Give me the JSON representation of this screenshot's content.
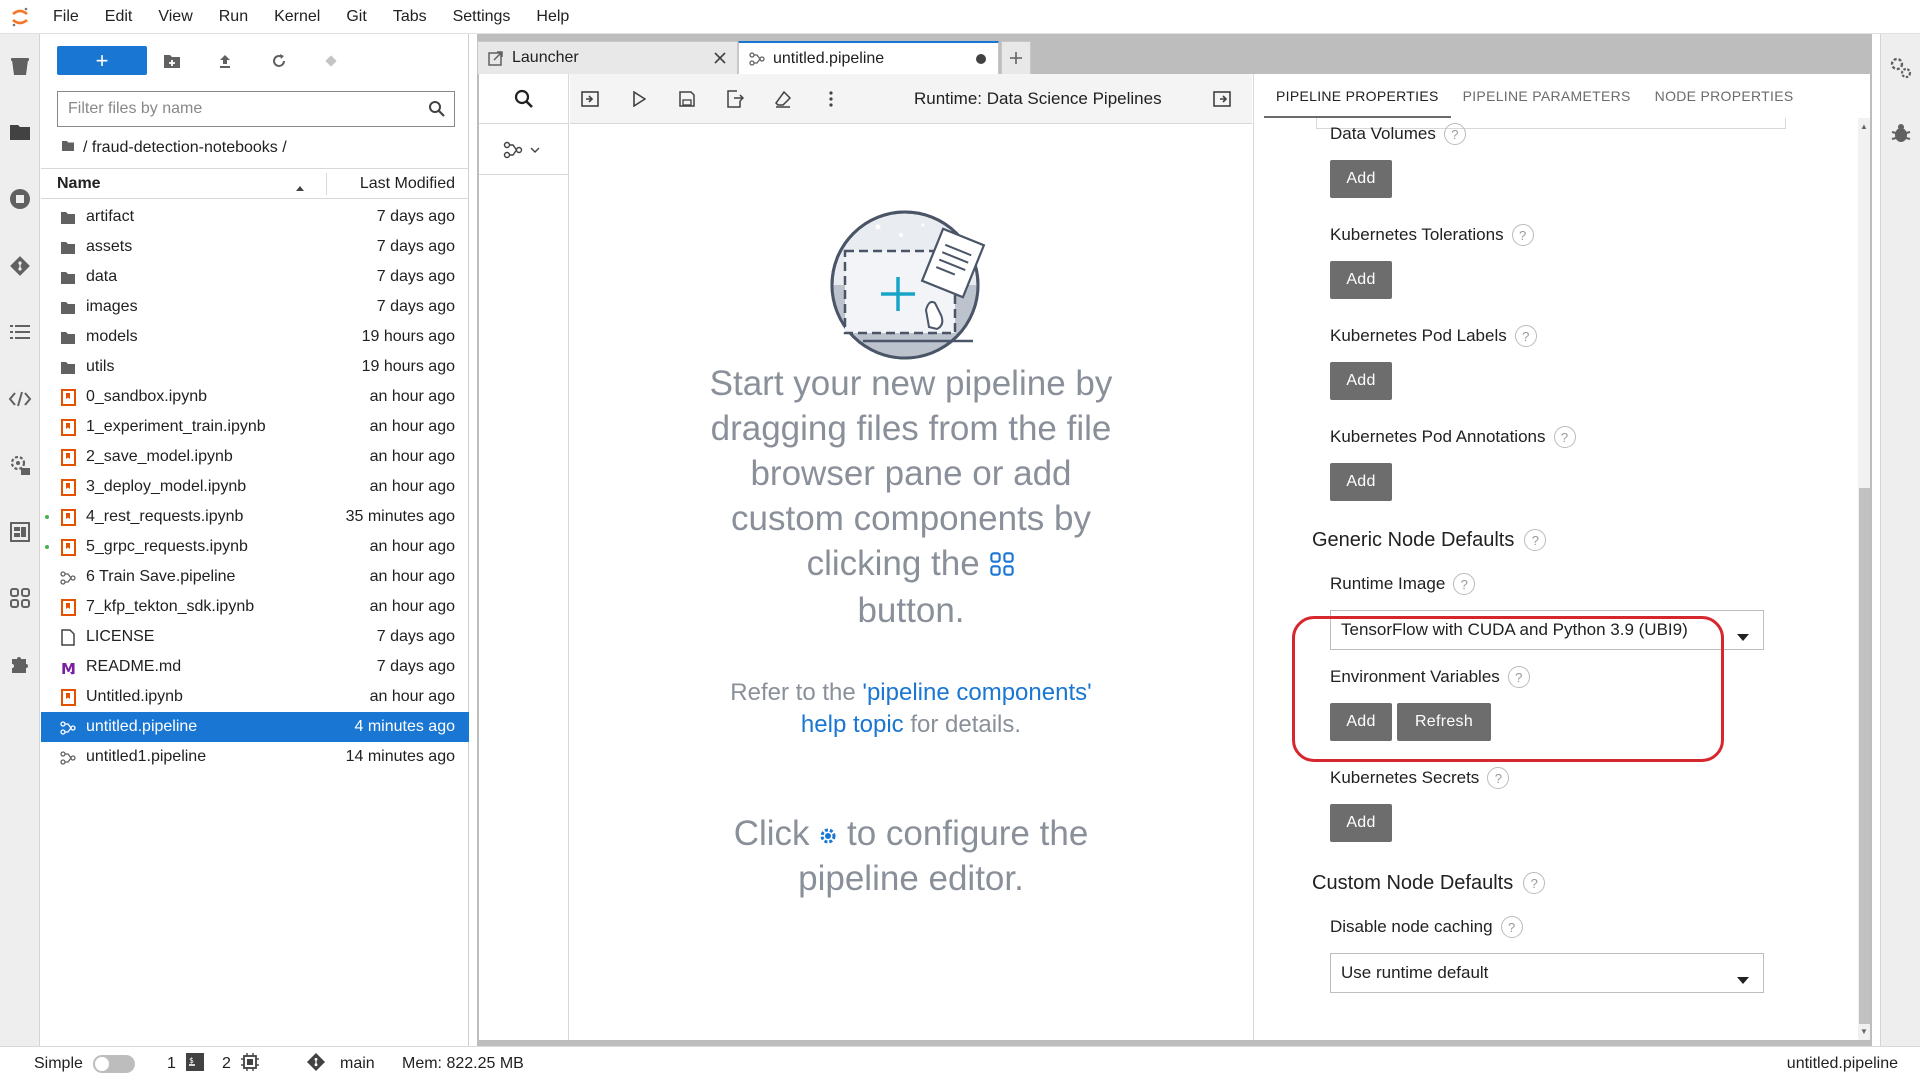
{
  "menubar": {
    "items": [
      "File",
      "Edit",
      "View",
      "Run",
      "Kernel",
      "Git",
      "Tabs",
      "Settings",
      "Help"
    ]
  },
  "file_browser": {
    "new_button_label": "+",
    "filter_placeholder": "Filter files by name",
    "breadcrumb": "/ fraud-detection-notebooks /",
    "header_name": "Name",
    "header_modified": "Last Modified",
    "files": [
      {
        "name": "artifact",
        "modified": "7 days ago",
        "type": "folder"
      },
      {
        "name": "assets",
        "modified": "7 days ago",
        "type": "folder"
      },
      {
        "name": "data",
        "modified": "7 days ago",
        "type": "folder"
      },
      {
        "name": "images",
        "modified": "7 days ago",
        "type": "folder"
      },
      {
        "name": "models",
        "modified": "19 hours ago",
        "type": "folder"
      },
      {
        "name": "utils",
        "modified": "19 hours ago",
        "type": "folder"
      },
      {
        "name": "0_sandbox.ipynb",
        "modified": "an hour ago",
        "type": "notebook"
      },
      {
        "name": "1_experiment_train.ipynb",
        "modified": "an hour ago",
        "type": "notebook"
      },
      {
        "name": "2_save_model.ipynb",
        "modified": "an hour ago",
        "type": "notebook"
      },
      {
        "name": "3_deploy_model.ipynb",
        "modified": "an hour ago",
        "type": "notebook"
      },
      {
        "name": "4_rest_requests.ipynb",
        "modified": "35 minutes ago",
        "type": "notebook",
        "running": true
      },
      {
        "name": "5_grpc_requests.ipynb",
        "modified": "an hour ago",
        "type": "notebook",
        "running": true
      },
      {
        "name": "6 Train Save.pipeline",
        "modified": "an hour ago",
        "type": "pipeline"
      },
      {
        "name": "7_kfp_tekton_sdk.ipynb",
        "modified": "an hour ago",
        "type": "notebook"
      },
      {
        "name": "LICENSE",
        "modified": "7 days ago",
        "type": "file"
      },
      {
        "name": "README.md",
        "modified": "7 days ago",
        "type": "markdown"
      },
      {
        "name": "Untitled.ipynb",
        "modified": "an hour ago",
        "type": "notebook"
      },
      {
        "name": "untitled.pipeline",
        "modified": "4 minutes ago",
        "type": "pipeline",
        "selected": true
      },
      {
        "name": "untitled1.pipeline",
        "modified": "14 minutes ago",
        "type": "pipeline"
      }
    ]
  },
  "tabs": [
    {
      "label": "Launcher",
      "active": false
    },
    {
      "label": "untitled.pipeline",
      "active": true
    }
  ],
  "canvas_toolbar": {
    "runtime_label": "Runtime: Data Science Pipelines"
  },
  "canvas": {
    "empty_main": "Start your new pipeline by dragging files from the file browser pane or add custom components by clicking the",
    "empty_main_end": "button.",
    "refer_prefix": "Refer to the ",
    "refer_link": "'pipeline components' help topic",
    "refer_suffix": " for details.",
    "click_prefix": "Click ",
    "click_suffix": " to configure the pipeline editor."
  },
  "properties": {
    "tabs": [
      "PIPELINE PROPERTIES",
      "PIPELINE PARAMETERS",
      "NODE PROPERTIES"
    ],
    "data_volumes": "Data Volumes",
    "k8s_tolerations": "Kubernetes Tolerations",
    "k8s_pod_labels": "Kubernetes Pod Labels",
    "k8s_pod_annotations": "Kubernetes Pod Annotations",
    "generic_node_defaults": "Generic Node Defaults",
    "runtime_image_label": "Runtime Image",
    "runtime_image_value": "TensorFlow with CUDA and Python 3.9 (UBI9)",
    "env_vars": "Environment Variables",
    "k8s_secrets": "Kubernetes Secrets",
    "custom_node_defaults": "Custom Node Defaults",
    "disable_caching_label": "Disable node caching",
    "disable_caching_value": "Use runtime default",
    "add_label": "Add",
    "refresh_label": "Refresh",
    "help_glyph": "?"
  },
  "statusbar": {
    "simple_label": "Simple",
    "terminals_count": "1",
    "kernels_count": "2",
    "git_branch": "main",
    "memory": "Mem: 822.25 MB",
    "current_file": "untitled.pipeline"
  },
  "colors": {
    "accent": "#1976d2",
    "highlight": "#d6262e",
    "notebook_icon": "#e65100"
  }
}
